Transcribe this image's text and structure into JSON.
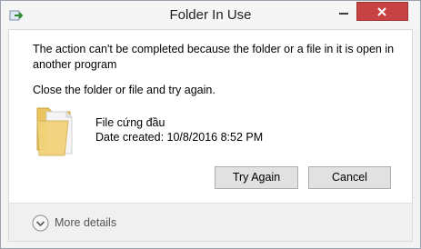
{
  "window": {
    "title": "Folder In Use"
  },
  "message": {
    "primary": "The action can't be completed because the folder or a file in it is open in another program",
    "secondary": "Close the folder or file and try again."
  },
  "item": {
    "name": "File cứng đầu",
    "date_created": "Date created: 10/8/2016 8:52 PM"
  },
  "buttons": {
    "try_again": "Try Again",
    "cancel": "Cancel"
  },
  "footer": {
    "more_details": "More details"
  },
  "colors": {
    "close_button": "#c74343",
    "folder": "#f1d27a"
  }
}
